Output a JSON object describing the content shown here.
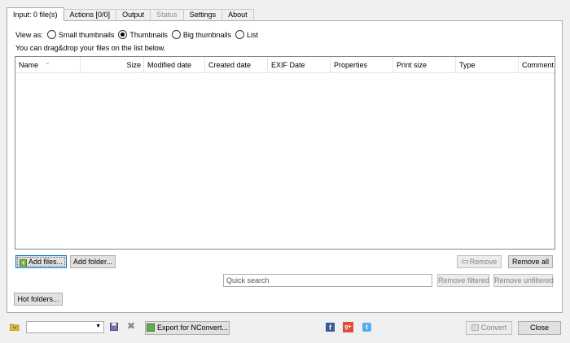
{
  "tabs": [
    {
      "label": "Input: 0 file(s)",
      "active": true
    },
    {
      "label": "Actions [0/0]"
    },
    {
      "label": "Output"
    },
    {
      "label": "Status",
      "disabled": true
    },
    {
      "label": "Settings"
    },
    {
      "label": "About"
    }
  ],
  "view_as": {
    "label": "View as:",
    "options": [
      "Small thumbnails",
      "Thumbnails",
      "Big thumbnails",
      "List"
    ],
    "selected": "Thumbnails"
  },
  "hint": "You can drag&drop your files on the list below.",
  "columns": [
    "Name",
    "Size",
    "Modified date",
    "Created date",
    "EXIF Date",
    "Properties",
    "Print size",
    "Type",
    "Comment"
  ],
  "buttons": {
    "add_files": "Add files...",
    "add_folder": "Add folder...",
    "remove": "Remove",
    "remove_all": "Remove all",
    "remove_filtered": "Remove filtered",
    "remove_unfiltered": "Remove unfiltered",
    "hot_folders": "Hot folders...",
    "export": "Export for NConvert...",
    "convert": "Convert",
    "close": "Close"
  },
  "search": {
    "placeholder": "Quick search",
    "value": ""
  },
  "preset_select": {
    "value": ""
  },
  "icons": {
    "add": "plus-icon",
    "folder": "folder-icon",
    "save": "floppy-icon",
    "delete": "cross-icon",
    "export": "export-icon",
    "facebook": "facebook-icon",
    "google": "google-plus-icon",
    "twitter": "twitter-icon",
    "remove": "remove-icon",
    "convert": "convert-icon"
  }
}
